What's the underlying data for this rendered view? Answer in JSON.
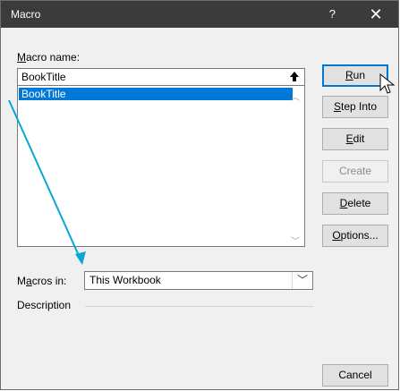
{
  "window": {
    "title": "Macro",
    "help_glyph": "?",
    "close_glyph": "✕"
  },
  "macro_name": {
    "label_prefix": "M",
    "label_rest": "acro name:",
    "value": "BookTitle"
  },
  "macro_list": {
    "items": [
      "BookTitle"
    ],
    "selected_index": 0
  },
  "buttons": {
    "run": {
      "u": "R",
      "rest": "un"
    },
    "step_into": {
      "u": "S",
      "rest": "tep Into"
    },
    "edit": {
      "u": "E",
      "rest": "dit"
    },
    "create": {
      "label": "Create"
    },
    "delete": {
      "u": "D",
      "rest": "elete"
    },
    "options": {
      "u": "O",
      "rest": "ptions..."
    },
    "cancel": {
      "label": "Cancel"
    }
  },
  "macros_in": {
    "label_a": "M",
    "label_u": "a",
    "label_rest": "cros in:",
    "value": "This Workbook"
  },
  "description": {
    "label": "Description"
  },
  "colors": {
    "titlebar": "#3b3b3b",
    "selection": "#0078d7",
    "annotation_arrow": "#0aa6d6"
  },
  "icons": [
    "up-arrow-icon",
    "scroll-up-icon",
    "scroll-down-icon",
    "chevron-down-icon",
    "mouse-pointer-icon",
    "annotation-arrow-icon"
  ]
}
